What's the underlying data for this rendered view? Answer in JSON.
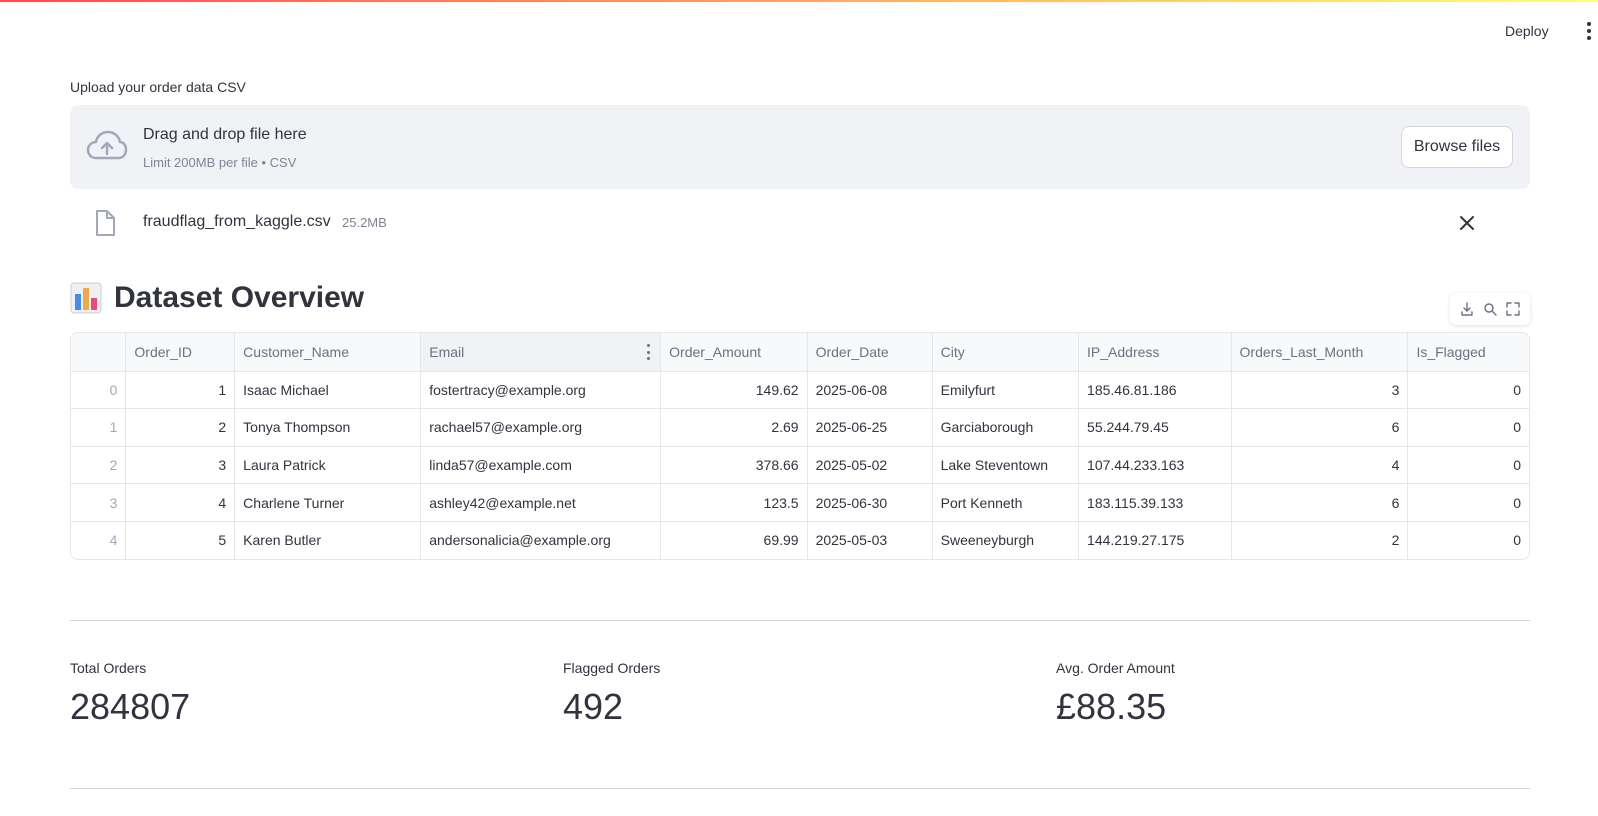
{
  "header": {
    "deploy_label": "Deploy"
  },
  "uploader": {
    "label": "Upload your order data CSV",
    "drop_title": "Drag and drop file here",
    "drop_subtitle": "Limit 200MB per file • CSV",
    "browse_label": "Browse files",
    "file_name": "fraudflag_from_kaggle.csv",
    "file_size": "25.2MB"
  },
  "section": {
    "title": "Dataset Overview",
    "icon": "bar-chart-emoji"
  },
  "table": {
    "columns": [
      "",
      "Order_ID",
      "Customer_Name",
      "Email",
      "Order_Amount",
      "Order_Date",
      "City",
      "IP_Address",
      "Orders_Last_Month",
      "Is_Flagged"
    ],
    "rows": [
      [
        "0",
        "1",
        "Isaac Michael",
        "fostertracy@example.org",
        "149.62",
        "2025-06-08",
        "Emilyfurt",
        "185.46.81.186",
        "3",
        "0"
      ],
      [
        "1",
        "2",
        "Tonya Thompson",
        "rachael57@example.org",
        "2.69",
        "2025-06-25",
        "Garciaborough",
        "55.244.79.45",
        "6",
        "0"
      ],
      [
        "2",
        "3",
        "Laura Patrick",
        "linda57@example.com",
        "378.66",
        "2025-05-02",
        "Lake Steventown",
        "107.44.233.163",
        "4",
        "0"
      ],
      [
        "3",
        "4",
        "Charlene Turner",
        "ashley42@example.net",
        "123.5",
        "2025-06-30",
        "Port Kenneth",
        "183.115.39.133",
        "6",
        "0"
      ],
      [
        "4",
        "5",
        "Karen Butler",
        "andersonalicia@example.org",
        "69.99",
        "2025-05-03",
        "Sweeneyburgh",
        "144.219.27.175",
        "2",
        "0"
      ]
    ]
  },
  "metrics": [
    {
      "label": "Total Orders",
      "value": "284807"
    },
    {
      "label": "Flagged Orders",
      "value": "492"
    },
    {
      "label": "Avg. Order Amount",
      "value": "£88.35"
    }
  ],
  "colors": {
    "text": "#31333f",
    "muted": "#808495",
    "dropzone_bg": "#f0f2f6",
    "border": "#e6e7ea"
  }
}
